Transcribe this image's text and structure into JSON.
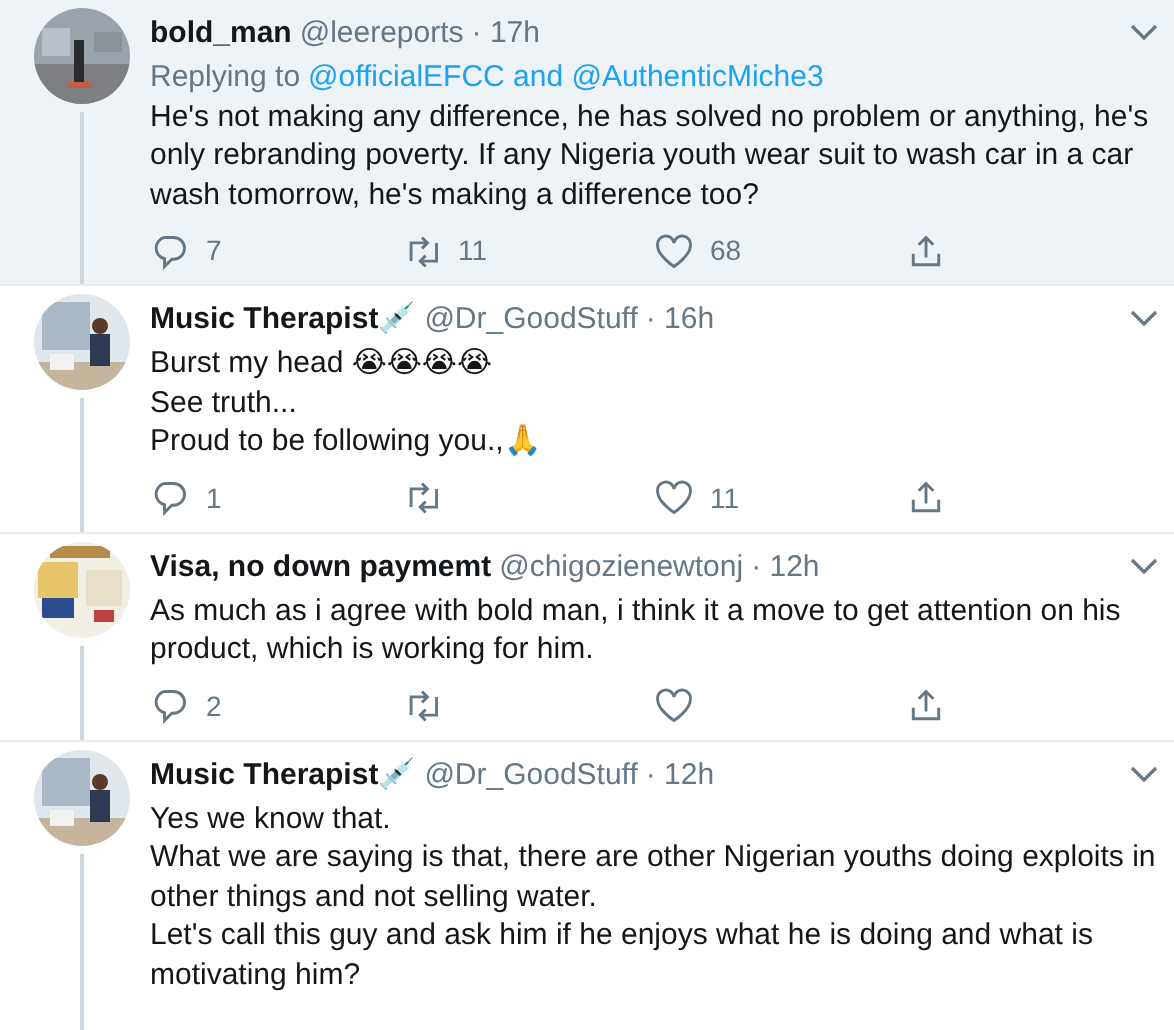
{
  "tweets": [
    {
      "name": "bold_man",
      "handle": "@leereports",
      "time": "· 17h",
      "highlighted": true,
      "replying_prefix": "Replying to",
      "replying_to": "@officialEFCC and @AuthenticMiche3",
      "lines": [
        "He's not making any difference, he has solved no problem or anything, he's only rebranding poverty. If any Nigeria youth wear suit to wash car in a car wash tomorrow, he's making a difference too?"
      ],
      "counts": {
        "reply": "7",
        "retweet": "11",
        "like": "68"
      }
    },
    {
      "name": "Music Therapist💉",
      "handle": "@Dr_GoodStuff",
      "time": "· 16h",
      "highlighted": false,
      "lines": [
        "Burst my head 😭😭😭😭",
        "See truth...",
        "Proud to be following you.,🙏"
      ],
      "counts": {
        "reply": "1",
        "like": "11"
      }
    },
    {
      "name": "Visa, no down paymemt",
      "handle": "@chigozienewtonj",
      "time": "· 12h",
      "highlighted": false,
      "lines": [
        "As much as i agree with bold man, i think it a move to get attention on his product, which is working for him."
      ],
      "counts": {
        "reply": "2"
      }
    },
    {
      "name": "Music Therapist💉",
      "handle": "@Dr_GoodStuff",
      "time": "· 12h",
      "highlighted": false,
      "lines": [
        "Yes we know that.",
        "What we are saying is that, there are other Nigerian youths doing exploits in other things and not selling water.",
        "Let's call this guy and ask him if he enjoys what he is doing and what is motivating him?"
      ]
    }
  ]
}
